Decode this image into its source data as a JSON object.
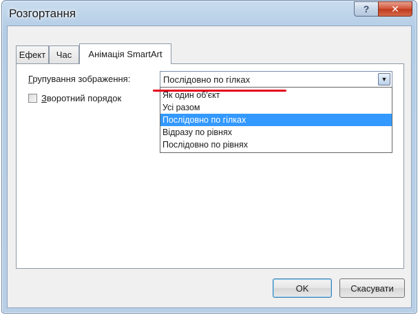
{
  "window": {
    "title": "Розгортання",
    "help_button": "?",
    "close_button": "✕"
  },
  "tabs": [
    {
      "label": "Ефект",
      "active": false
    },
    {
      "label": "Час",
      "active": false
    },
    {
      "label": "Анімація SmartArt",
      "active": true
    }
  ],
  "smartart": {
    "group_label_accel": "Г",
    "group_label_rest": "рупування зображення:",
    "combo_value": "Послідовно по гілках",
    "reverse_label_accel": "З",
    "reverse_label_rest": "воротний порядок",
    "reverse_checked": false,
    "options": [
      "Як один об'єкт",
      "Усі разом",
      "Послідовно по гілках",
      "Відразу по рівнях",
      "Послідовно по рівнях"
    ],
    "selected_index": 2
  },
  "buttons": {
    "ok": "OK",
    "cancel": "Скасувати"
  },
  "colors": {
    "selection": "#3399ff",
    "annotation_underline": "#e4001b"
  }
}
